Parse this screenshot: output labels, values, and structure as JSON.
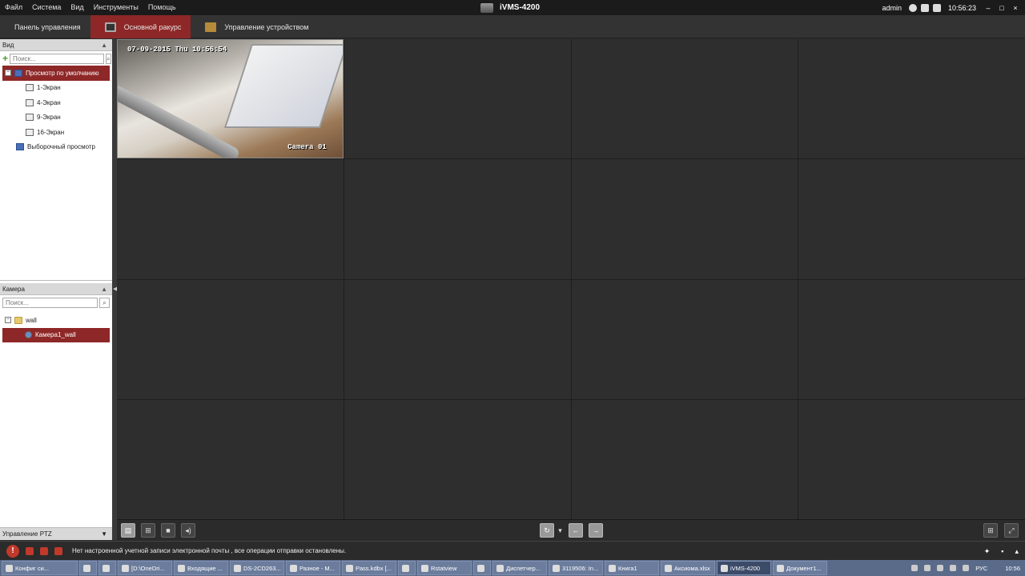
{
  "menubar": {
    "items": [
      "Файл",
      "Система",
      "Вид",
      "Инструменты",
      "Помощь"
    ],
    "app_title": "iVMS-4200",
    "user": "admin",
    "time": "10:56:23",
    "window_buttons": [
      "‒",
      "□",
      "×"
    ]
  },
  "tabs": [
    {
      "label": "Панель управления",
      "icon": "grid-icon",
      "active": false
    },
    {
      "label": "Основной ракурс",
      "icon": "camera-view-icon",
      "active": true
    },
    {
      "label": "Управление устройством",
      "icon": "device-icon",
      "active": false
    }
  ],
  "view_panel": {
    "title": "Вид",
    "search_placeholder": "Поиск...",
    "items": [
      {
        "label": "Просмотр по умолчанию",
        "selected": true
      },
      {
        "label": "1-Экран"
      },
      {
        "label": "4-Экран"
      },
      {
        "label": "9-Экран"
      },
      {
        "label": "16-Экран"
      },
      {
        "label": "Выборочный просмотр"
      }
    ]
  },
  "camera_panel": {
    "title": "Камера",
    "search_placeholder": "Поиск...",
    "folder": "wall",
    "camera": "Камера1_wall"
  },
  "ptz_panel": {
    "title": "Управление PTZ"
  },
  "live_view": {
    "timestamp": "07-09-2015 Thu 10:56:54",
    "camera_label": "Camera 01"
  },
  "notification": {
    "message": "Нет настроенной учетной записи электронной почты , все операции отправки остановлены."
  },
  "taskbar": {
    "tasks": [
      "Конфиг си...",
      "",
      "",
      "[D:\\OneDri...",
      "Входящие ...",
      "DS-2CD263...",
      "Разное - М...",
      "Pass.kdbx [...",
      "",
      "Rstatview",
      "",
      "Диспетчер...",
      "3119506: In...",
      "Книга1",
      "Аксиома.xlsx",
      "iVMS-4200",
      "Документ1..."
    ],
    "lang": "РУС",
    "clock": "10:56"
  }
}
